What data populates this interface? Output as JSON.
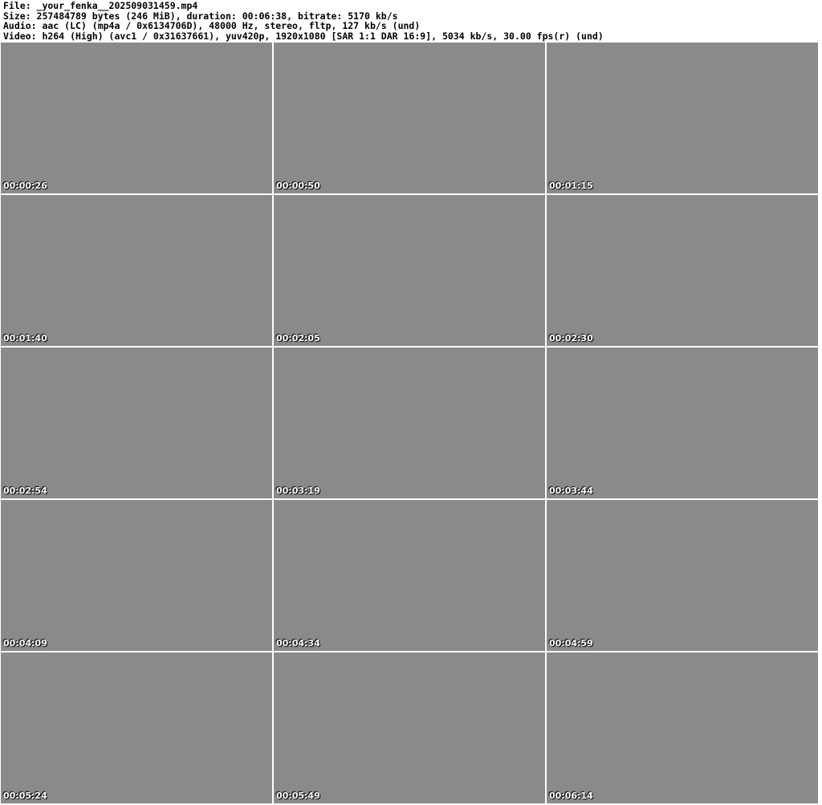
{
  "header": {
    "file": "File: _your_fenka__202509031459.mp4",
    "size": "Size: 257484789 bytes (246 MiB), duration: 00:06:38, bitrate: 5170 kb/s",
    "audio": "Audio: aac (LC) (mp4a / 0x6134706D), 48000 Hz, stereo, fltp, 127 kb/s (und)",
    "video": "Video: h264 (High) (avc1 / 0x31637661), yuv420p, 1920x1080 [SAR 1:1 DAR 16:9], 5034 kb/s, 30.00 fps(r) (und)"
  },
  "frames": [
    "00:00:26",
    "00:00:50",
    "00:01:15",
    "00:01:40",
    "00:02:05",
    "00:02:30",
    "00:02:54",
    "00:03:19",
    "00:03:44",
    "00:04:09",
    "00:04:34",
    "00:04:59",
    "00:05:24",
    "00:05:49",
    "00:06:14"
  ]
}
